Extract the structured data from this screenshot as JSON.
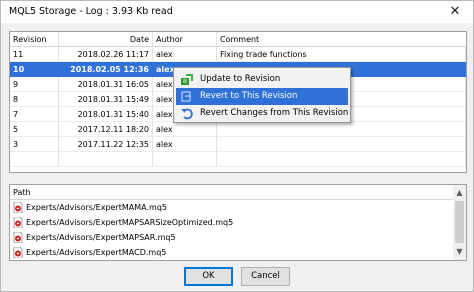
{
  "window": {
    "title": "MQL5 Storage - Log : 3.93 Kb read",
    "close_glyph": "✕"
  },
  "log_table": {
    "columns": [
      "Revision",
      "Date",
      "Author",
      "Comment"
    ],
    "rows": [
      {
        "revision": "11",
        "date": "2018.02.26 11:17",
        "author": "alex",
        "comment": "Fixing trade functions",
        "selected": false
      },
      {
        "revision": "10",
        "date": "2018.02.05 12:36",
        "author": "alex",
        "comment": "",
        "selected": true
      },
      {
        "revision": "9",
        "date": "2018.01.31 16:05",
        "author": "alex",
        "comment": "",
        "selected": false
      },
      {
        "revision": "8",
        "date": "2018.01.31 15:49",
        "author": "alex",
        "comment": "",
        "selected": false
      },
      {
        "revision": "7",
        "date": "2018.01.31 15:40",
        "author": "alex",
        "comment": "",
        "selected": false
      },
      {
        "revision": "5",
        "date": "2017.12.11 18:20",
        "author": "alex",
        "comment": "",
        "selected": false
      },
      {
        "revision": "3",
        "date": "2017.11.22 12:35",
        "author": "alex",
        "comment": "",
        "selected": false
      }
    ]
  },
  "context_menu": {
    "items": [
      {
        "label": "Update to Revision",
        "icon": "update-icon",
        "highlighted": false
      },
      {
        "label": "Revert to This Revision",
        "icon": "revert-icon",
        "highlighted": true
      },
      {
        "label": "Revert Changes from This Revision",
        "icon": "undo-icon",
        "highlighted": false
      }
    ]
  },
  "paths": {
    "header": "Path",
    "items": [
      "Experts/Advisors/ExpertMAMA.mq5",
      "Experts/Advisors/ExpertMAPSARSizeOptimized.mq5",
      "Experts/Advisors/ExpertMAPSAR.mq5",
      "Experts/Advisors/ExpertMACD.mq5"
    ],
    "file_icon": "mq5-file-icon"
  },
  "buttons": {
    "ok": "OK",
    "cancel": "Cancel"
  },
  "colors": {
    "selection": "#3071d8",
    "default_button_border": "#0078d7",
    "file_icon_red": "#d42020"
  }
}
